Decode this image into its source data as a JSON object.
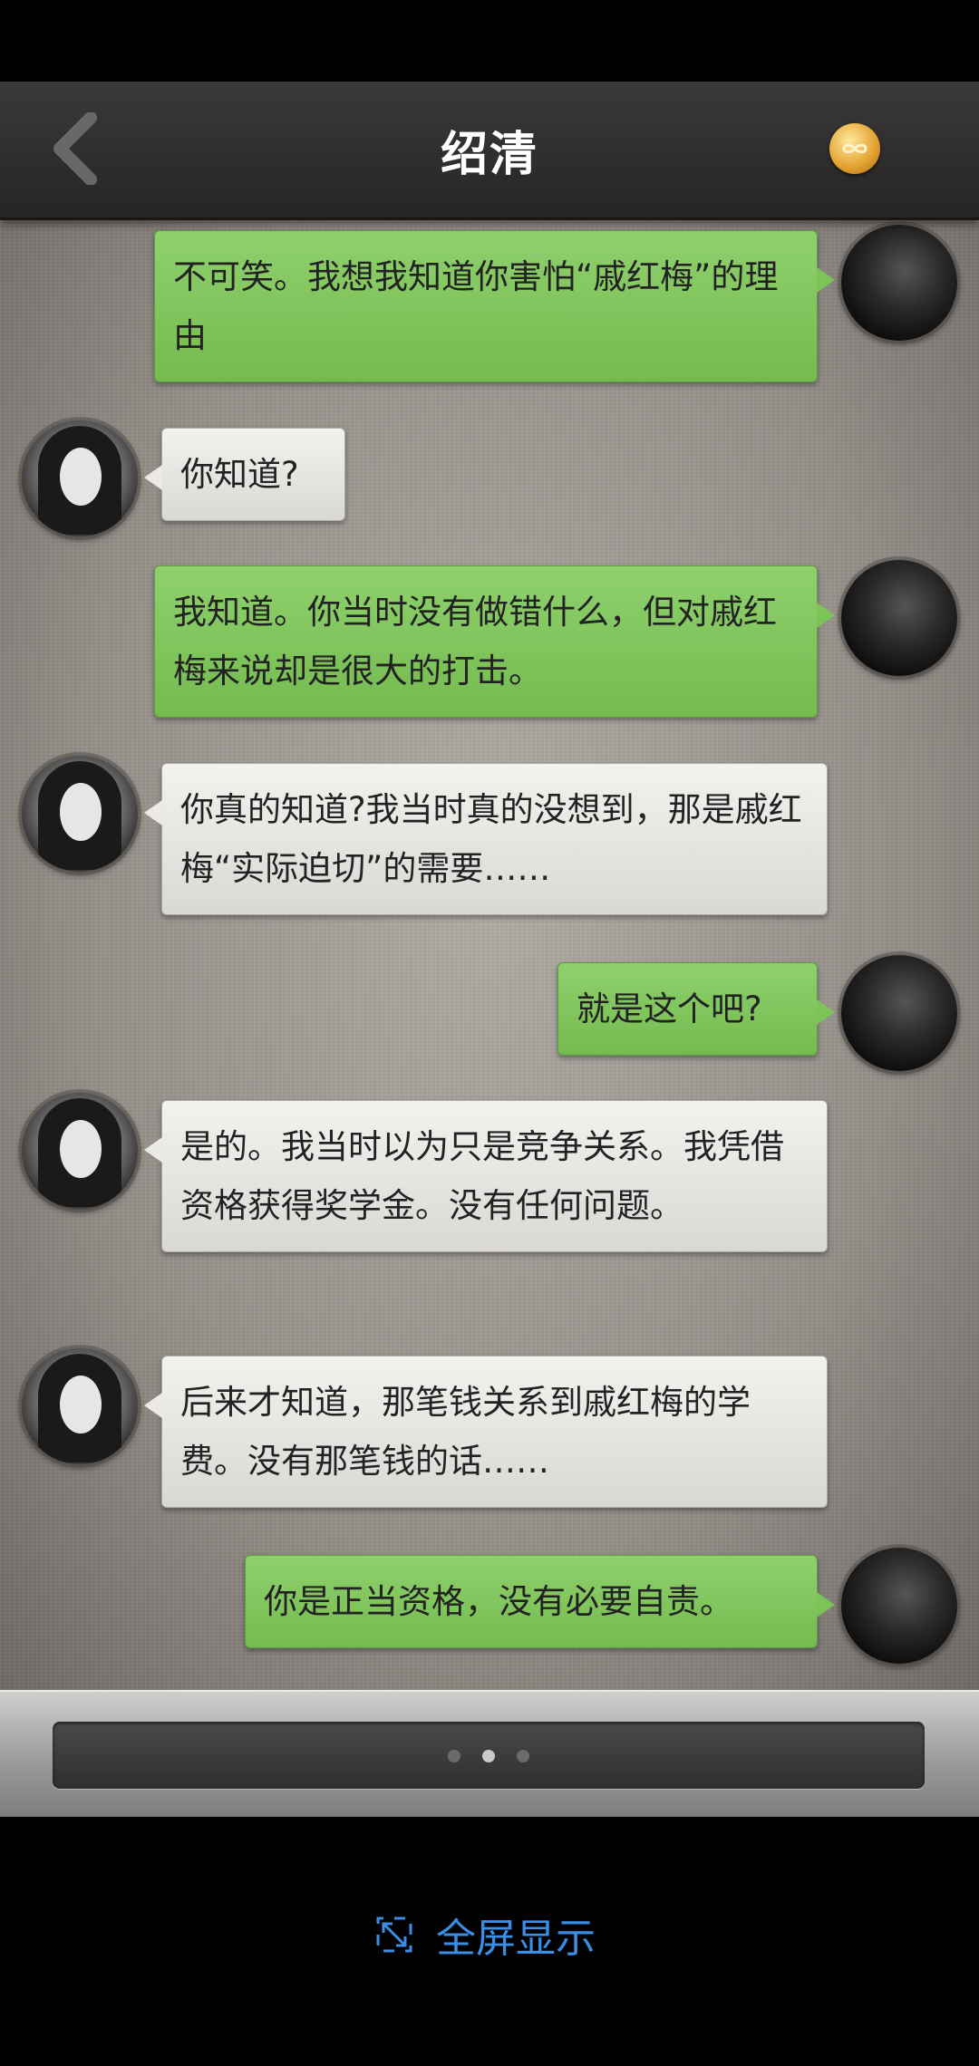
{
  "header": {
    "title": "绍清",
    "back_icon": "chevron-left-icon",
    "coin_icon": "infinity-coin-icon",
    "accent": "#e2a02d"
  },
  "messages": [
    {
      "from": "me",
      "text": "不可笑。我想我知道你害怕“戚红梅”的理由"
    },
    {
      "from": "her",
      "text": "你知道?"
    },
    {
      "from": "me",
      "text": "我知道。你当时没有做错什么，但对戚红梅来说却是很大的打击。"
    },
    {
      "from": "her",
      "text": "你真的知道?我当时真的没想到，那是戚红梅“实际迫切”的需要……"
    },
    {
      "from": "me",
      "text": "就是这个吧?"
    },
    {
      "from": "her",
      "text": "是的。我当时以为只是竞争关系。我凭借资格获得奖学金。没有任何问题。"
    },
    {
      "from": "her",
      "text": "后来才知道，那笔钱关系到戚红梅的学费。没有那笔钱的话……"
    },
    {
      "from": "me",
      "text": "你是正当资格，没有必要自责。"
    }
  ],
  "pager": {
    "pages": 3,
    "active": 2
  },
  "footer": {
    "fullscreen_label": "全屏显示",
    "fullscreen_icon": "expand-arrows-icon",
    "color": "#3a8ee6"
  },
  "colors": {
    "outgoing_bubble": "#7cc458",
    "incoming_bubble": "#eceae7",
    "header": "#2f2e2c"
  }
}
